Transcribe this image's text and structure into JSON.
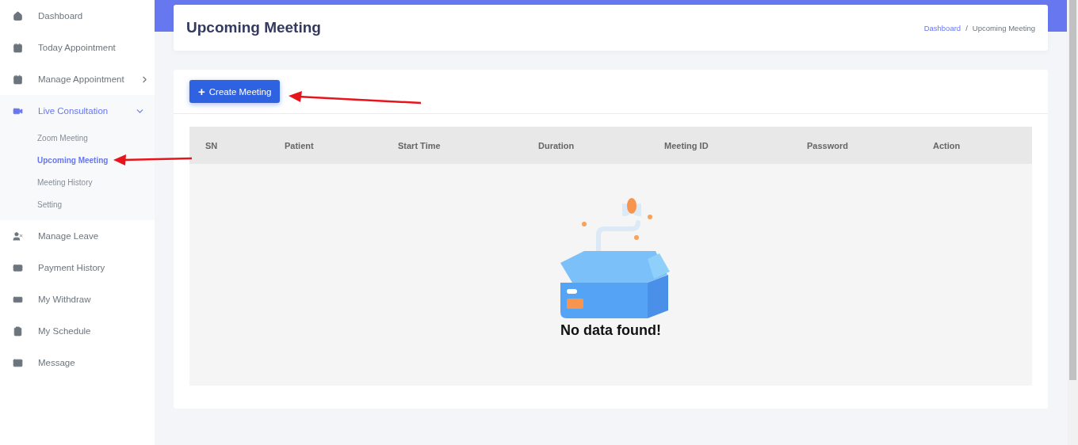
{
  "sidebar": {
    "items": [
      {
        "label": "Dashboard",
        "kind": "link",
        "selected": false
      },
      {
        "label": "Today Appointment",
        "kind": "link",
        "selected": false
      },
      {
        "label": "Manage Appointment",
        "kind": "group",
        "selected": false,
        "expanded": false
      },
      {
        "label": "Live Consultation",
        "kind": "group",
        "selected": true,
        "expanded": true,
        "children": [
          {
            "label": "Zoom Meeting",
            "selected": false
          },
          {
            "label": "Upcoming Meeting",
            "selected": true
          },
          {
            "label": "Meeting History",
            "selected": false
          },
          {
            "label": "Setting",
            "selected": false
          }
        ]
      },
      {
        "label": "Manage Leave",
        "kind": "link",
        "selected": false
      },
      {
        "label": "Payment History",
        "kind": "link",
        "selected": false
      },
      {
        "label": "My Withdraw",
        "kind": "link",
        "selected": false
      },
      {
        "label": "My Schedule",
        "kind": "link",
        "selected": false
      },
      {
        "label": "Message",
        "kind": "link",
        "selected": false
      }
    ]
  },
  "header": {
    "title": "Upcoming Meeting",
    "breadcrumb_separator": "/",
    "breadcrumb": [
      {
        "label": "Dashboard",
        "kind": "link"
      },
      {
        "label": "Upcoming Meeting",
        "kind": "current"
      }
    ]
  },
  "toolbar": {
    "button": {
      "icon": "+",
      "label": "Create Meeting"
    }
  },
  "table": {
    "columns": [
      "SN",
      "Patient",
      "Start Time",
      "Duration",
      "Meeting ID",
      "Password",
      "Action"
    ],
    "empty_message": "No data found!"
  }
}
